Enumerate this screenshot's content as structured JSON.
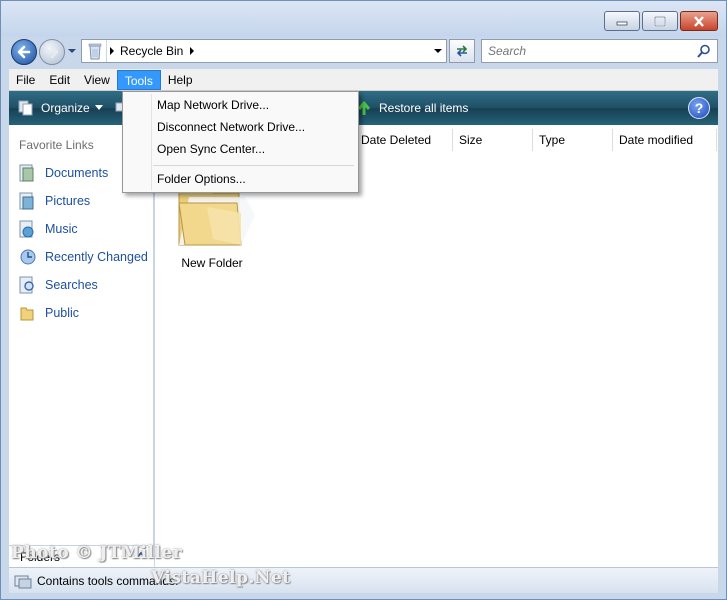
{
  "address_bar": {
    "location_icon": "recycle-bin-icon",
    "path": [
      "Recycle Bin"
    ]
  },
  "search": {
    "placeholder": "Search"
  },
  "menu": {
    "items": [
      "File",
      "Edit",
      "View",
      "Tools",
      "Help"
    ],
    "active": "Tools"
  },
  "toolbar": {
    "organize_label": "Organize",
    "restore_label": "Restore all items",
    "help_label": "?"
  },
  "tools_menu": {
    "items": [
      "Map Network Drive...",
      "Disconnect Network Drive...",
      "Open Sync Center...",
      "Folder Options..."
    ]
  },
  "nav_pane": {
    "title": "Favorite Links",
    "links": [
      {
        "label": "Documents",
        "icon": "documents-icon"
      },
      {
        "label": "Pictures",
        "icon": "pictures-icon"
      },
      {
        "label": "Music",
        "icon": "music-icon"
      },
      {
        "label": "Recently Changed",
        "icon": "recently-changed-icon"
      },
      {
        "label": "Searches",
        "icon": "searches-icon"
      },
      {
        "label": "Public",
        "icon": "public-folder-icon"
      }
    ],
    "folders_label": "Folders"
  },
  "content": {
    "columns": [
      "Date Deleted",
      "Size",
      "Type",
      "Date modified"
    ],
    "items": [
      {
        "label": "New Folder",
        "icon": "folder-icon"
      }
    ]
  },
  "status": {
    "text": "Contains tools commands."
  },
  "watermark": {
    "line1": "Photo © JTMiller",
    "line2": "VistaHelp.Net"
  },
  "colors": {
    "command_bar": "#1f4f64",
    "menu_highlight": "#3399ff",
    "link_text": "#1e4f9c"
  }
}
